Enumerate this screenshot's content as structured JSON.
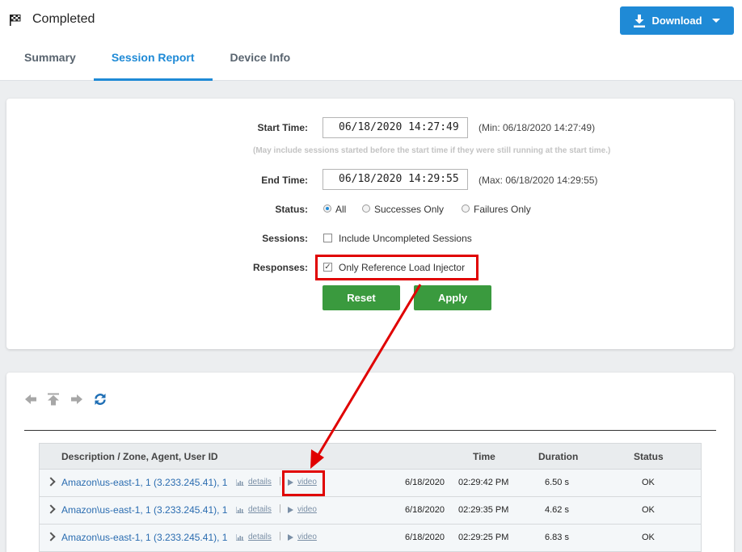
{
  "header": {
    "title": "Completed",
    "download_label": "Download",
    "tabs": [
      {
        "label": "Summary",
        "active": false
      },
      {
        "label": "Session Report",
        "active": true
      },
      {
        "label": "Device Info",
        "active": false
      }
    ]
  },
  "filters": {
    "start_label": "Start Time:",
    "start_value": "06/18/2020 14:27:49",
    "start_min": "(Min: 06/18/2020 14:27:49)",
    "start_note": "(May include sessions started before the start time if they were still running at the start time.)",
    "end_label": "End Time:",
    "end_value": "06/18/2020 14:29:55",
    "end_max": "(Max: 06/18/2020 14:29:55)",
    "status_label": "Status:",
    "status_options": [
      "All",
      "Successes Only",
      "Failures Only"
    ],
    "status_selected": "All",
    "sessions_label": "Sessions:",
    "sessions_option": "Include Uncompleted Sessions",
    "sessions_checked": false,
    "responses_label": "Responses:",
    "responses_option": "Only Reference Load Injector",
    "responses_checked": true,
    "reset_label": "Reset",
    "apply_label": "Apply"
  },
  "table": {
    "columns": [
      "Description / Zone, Agent, User ID",
      "Time",
      "Duration",
      "Status"
    ],
    "details_label": "details",
    "video_label": "video",
    "rows": [
      {
        "desc": "Amazon\\us-east-1, 1 (3.233.245.41), 1",
        "date": "6/18/2020",
        "time": "02:29:42 PM",
        "duration": "6.50 s",
        "status": "OK"
      },
      {
        "desc": "Amazon\\us-east-1, 1 (3.233.245.41), 1",
        "date": "6/18/2020",
        "time": "02:29:35 PM",
        "duration": "4.62 s",
        "status": "OK"
      },
      {
        "desc": "Amazon\\us-east-1, 1 (3.233.245.41), 1",
        "date": "6/18/2020",
        "time": "02:29:25 PM",
        "duration": "6.83 s",
        "status": "OK"
      }
    ]
  },
  "colors": {
    "accent": "#1f8ad6",
    "green": "#3a9a3e",
    "annotation": "#e00000"
  },
  "icons": [
    "flag-icon",
    "download-icon",
    "arrow-left-icon",
    "arrow-top-icon",
    "arrow-right-icon",
    "refresh-icon",
    "chart-icon",
    "play-icon",
    "chevron-right-icon"
  ]
}
